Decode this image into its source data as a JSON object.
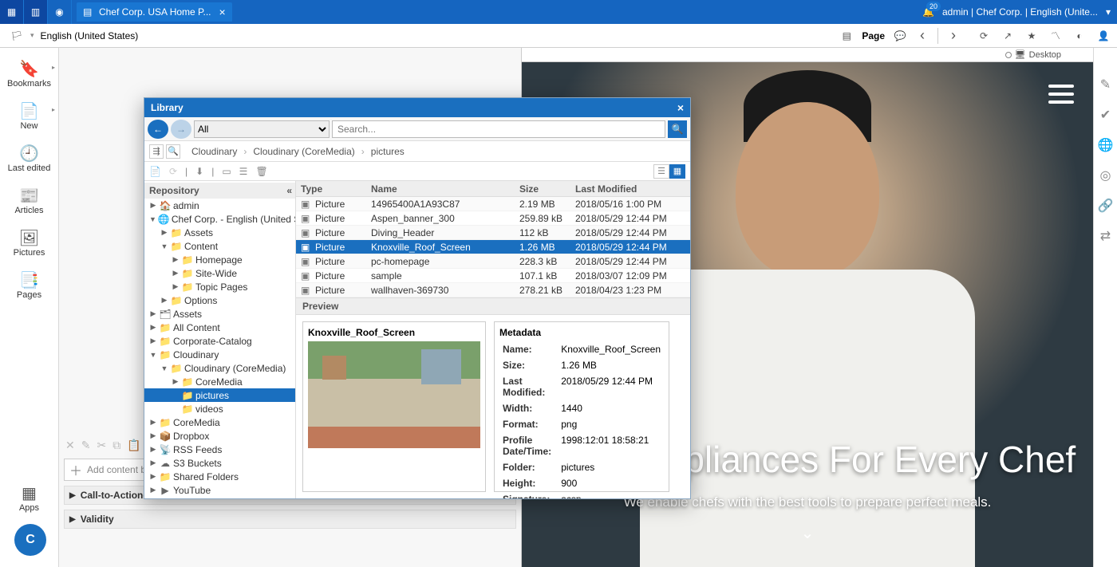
{
  "topbar": {
    "tab_title": "Chef Corp. USA Home P...",
    "notification_count": "20",
    "user_label": "admin | Chef Corp. | English (Unite..."
  },
  "toolbar": {
    "locale_label": "English (United States)",
    "page_label": "Page"
  },
  "sidebar": {
    "items": [
      {
        "label": "Bookmarks"
      },
      {
        "label": "New"
      },
      {
        "label": "Last edited"
      },
      {
        "label": "Articles"
      },
      {
        "label": "Pictures"
      },
      {
        "label": "Pages"
      }
    ],
    "apps_label": "Apps"
  },
  "ruler": {
    "desktop_label": "Desktop"
  },
  "hero": {
    "headline": "Great Appliances For Every Chef",
    "subline": "We enable chefs with the best tools to prepare perfect meals."
  },
  "editor": {
    "drop_hint": "Add content by dragging it from the Library here.",
    "cta_label": "Call-to-Action-Button",
    "validity_label": "Validity"
  },
  "library": {
    "title": "Library",
    "filter_all": "All",
    "search_placeholder": "Search...",
    "breadcrumb": [
      "Cloudinary",
      "Cloudinary (CoreMedia)",
      "pictures"
    ],
    "repo_header": "Repository",
    "columns": {
      "type": "Type",
      "name": "Name",
      "size": "Size",
      "mod": "Last Modified"
    },
    "rows": [
      {
        "type": "Picture",
        "name": "14965400A1A93C87",
        "size": "2.19 MB",
        "mod": "2018/05/16 1:00 PM"
      },
      {
        "type": "Picture",
        "name": "Aspen_banner_300",
        "size": "259.89 kB",
        "mod": "2018/05/29 12:44 PM"
      },
      {
        "type": "Picture",
        "name": "Diving_Header",
        "size": "112 kB",
        "mod": "2018/05/29 12:44 PM"
      },
      {
        "type": "Picture",
        "name": "Knoxville_Roof_Screen",
        "size": "1.26 MB",
        "mod": "2018/05/29 12:44 PM",
        "selected": true
      },
      {
        "type": "Picture",
        "name": "pc-homepage",
        "size": "228.3 kB",
        "mod": "2018/05/29 12:44 PM"
      },
      {
        "type": "Picture",
        "name": "sample",
        "size": "107.1 kB",
        "mod": "2018/03/07 12:09 PM"
      },
      {
        "type": "Picture",
        "name": "wallhaven-369730",
        "size": "278.21 kB",
        "mod": "2018/04/23 1:23 PM"
      }
    ],
    "preview_header": "Preview",
    "preview_title": "Knoxville_Roof_Screen",
    "metadata_header": "Metadata",
    "metadata": [
      {
        "k": "Name:",
        "v": "Knoxville_Roof_Screen"
      },
      {
        "k": "Size:",
        "v": "1.26 MB"
      },
      {
        "k": "Last Modified:",
        "v": "2018/05/29 12:44 PM"
      },
      {
        "k": "Width:",
        "v": "1440"
      },
      {
        "k": "Format:",
        "v": "png"
      },
      {
        "k": "Profile Date/Time:",
        "v": "1998:12:01 18:58:21"
      },
      {
        "k": "Folder:",
        "v": "pictures"
      },
      {
        "k": "Height:",
        "v": "900"
      },
      {
        "k": "Signature:",
        "v": "acsp"
      }
    ],
    "tree": [
      {
        "d": 0,
        "tw": "▶",
        "ic": "🏠",
        "label": "admin"
      },
      {
        "d": 0,
        "tw": "▼",
        "ic": "🌐",
        "label": "Chef Corp. - English (United States)"
      },
      {
        "d": 1,
        "tw": "▶",
        "ic": "📁",
        "label": "Assets"
      },
      {
        "d": 1,
        "tw": "▼",
        "ic": "📁",
        "label": "Content"
      },
      {
        "d": 2,
        "tw": "▶",
        "ic": "📁",
        "label": "Homepage"
      },
      {
        "d": 2,
        "tw": "▶",
        "ic": "📁",
        "label": "Site-Wide"
      },
      {
        "d": 2,
        "tw": "▶",
        "ic": "📁",
        "label": "Topic Pages"
      },
      {
        "d": 1,
        "tw": "▶",
        "ic": "📁",
        "label": "Options"
      },
      {
        "d": 0,
        "tw": "▶",
        "ic": "🗂",
        "label": "Assets"
      },
      {
        "d": 0,
        "tw": "▶",
        "ic": "📁",
        "label": "All Content"
      },
      {
        "d": 0,
        "tw": "▶",
        "ic": "📁",
        "label": "Corporate-Catalog"
      },
      {
        "d": 0,
        "tw": "▼",
        "ic": "📁",
        "label": "Cloudinary"
      },
      {
        "d": 1,
        "tw": "▼",
        "ic": "📁",
        "label": "Cloudinary (CoreMedia)"
      },
      {
        "d": 2,
        "tw": "▶",
        "ic": "📁",
        "label": "CoreMedia"
      },
      {
        "d": 2,
        "tw": "",
        "ic": "📁",
        "label": "pictures",
        "selected": true
      },
      {
        "d": 2,
        "tw": "",
        "ic": "📁",
        "label": "videos"
      },
      {
        "d": 0,
        "tw": "▶",
        "ic": "📁",
        "label": "CoreMedia"
      },
      {
        "d": 0,
        "tw": "▶",
        "ic": "📦",
        "label": "Dropbox"
      },
      {
        "d": 0,
        "tw": "▶",
        "ic": "📡",
        "label": "RSS Feeds"
      },
      {
        "d": 0,
        "tw": "▶",
        "ic": "☁",
        "label": "S3 Buckets"
      },
      {
        "d": 0,
        "tw": "▶",
        "ic": "📁",
        "label": "Shared Folders"
      },
      {
        "d": 0,
        "tw": "▶",
        "ic": "▶",
        "label": "YouTube"
      }
    ]
  }
}
